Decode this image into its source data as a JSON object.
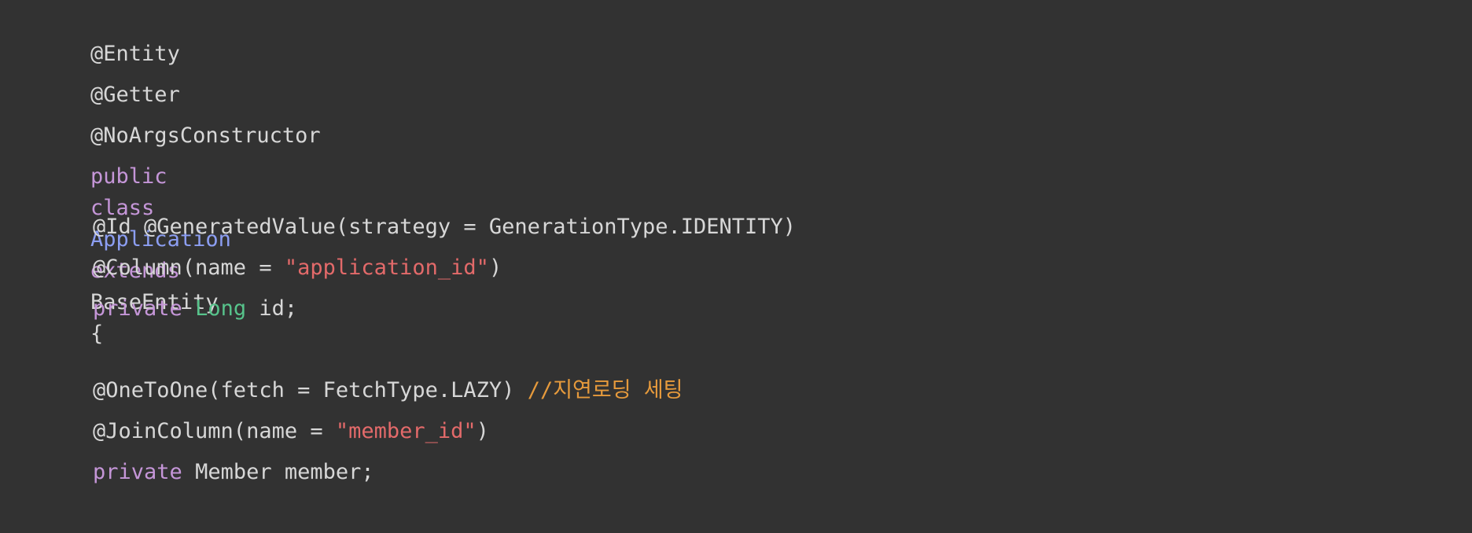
{
  "code": {
    "l1": {
      "a1": "@Entity"
    },
    "l2": {
      "a1": "@Getter"
    },
    "l3": {
      "a1": "@NoArgsConstructor"
    },
    "l4": {
      "kw1": "public",
      "kw2": "class",
      "cls1": "Application",
      "kw3": "extends",
      "t1": "BaseEntity",
      "p1": "{"
    },
    "l6": {
      "a1": "@Id @GeneratedValue(strategy = GenerationType.IDENTITY)"
    },
    "l7": {
      "a1": "@Column(name = ",
      "s1": "\"application_id\"",
      "p1": ")"
    },
    "l8": {
      "kw1": "private",
      "type1": "Long",
      "p1": "id;"
    },
    "l10": {
      "a1": "@OneToOne(fetch = FetchType.LAZY) ",
      "c1": "//지연로딩 세팅"
    },
    "l11": {
      "a1": "@JoinColumn(name = ",
      "s1": "\"member_id\"",
      "p1": ")"
    },
    "l12": {
      "kw1": "private",
      "t1": "Member member;"
    },
    "l13": {
      "p1": "}"
    }
  },
  "colors": {
    "background": "#323232",
    "default_text": "#d7d7d7",
    "keyword": "#c596d8",
    "class_name": "#8c9ef2",
    "type": "#57c38b",
    "string": "#e36a6a",
    "comment": "#e69a3c"
  }
}
